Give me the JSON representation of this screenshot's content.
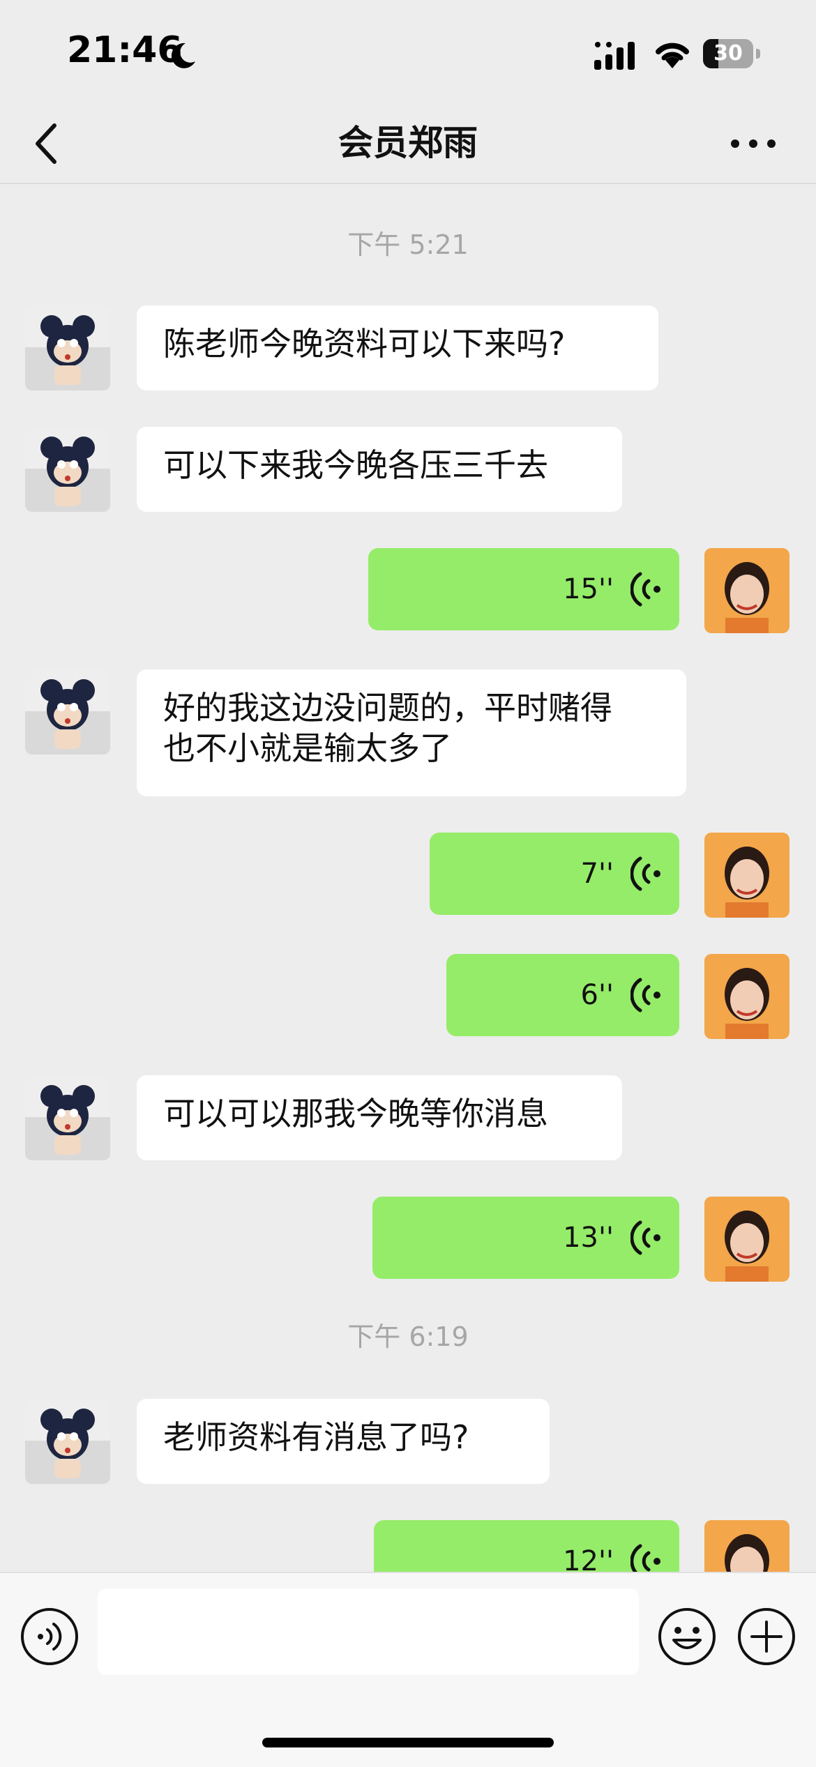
{
  "status_bar": {
    "time": "21:46",
    "battery": "30",
    "battery_level": 0.3
  },
  "header": {
    "title": "会员郑雨"
  },
  "messages": [
    {
      "type": "timestamp",
      "text": "下午 5:21"
    },
    {
      "type": "text",
      "side": "in",
      "text": "陈老师今晚资料可以下来吗?"
    },
    {
      "type": "text",
      "side": "in",
      "text": "可以下来我今晚各压三千去"
    },
    {
      "type": "voice",
      "side": "out",
      "duration": "15''"
    },
    {
      "type": "text",
      "side": "in",
      "text_lines": [
        "好的我这边没问题的，平时赌得",
        "也不小就是输太多了"
      ]
    },
    {
      "type": "voice",
      "side": "out",
      "duration": "7''"
    },
    {
      "type": "voice",
      "side": "out",
      "duration": "6''"
    },
    {
      "type": "text",
      "side": "in",
      "text": "可以可以那我今晚等你消息"
    },
    {
      "type": "voice",
      "side": "out",
      "duration": "13''"
    },
    {
      "type": "timestamp",
      "text": "下午 6:19"
    },
    {
      "type": "text",
      "side": "in",
      "text": "老师资料有消息了吗?"
    },
    {
      "type": "voice",
      "side": "out",
      "duration": "12''"
    }
  ],
  "input": {
    "value": "",
    "placeholder": ""
  },
  "icons": {
    "back": "chevron-left-icon",
    "more": "more-dots-icon",
    "voice_toggle": "voice-input-icon",
    "emoji": "emoji-icon",
    "plus": "plus-icon"
  },
  "colors": {
    "outgoing_bubble": "#95ec69",
    "incoming_bubble": "#ffffff",
    "background": "#ededed"
  }
}
